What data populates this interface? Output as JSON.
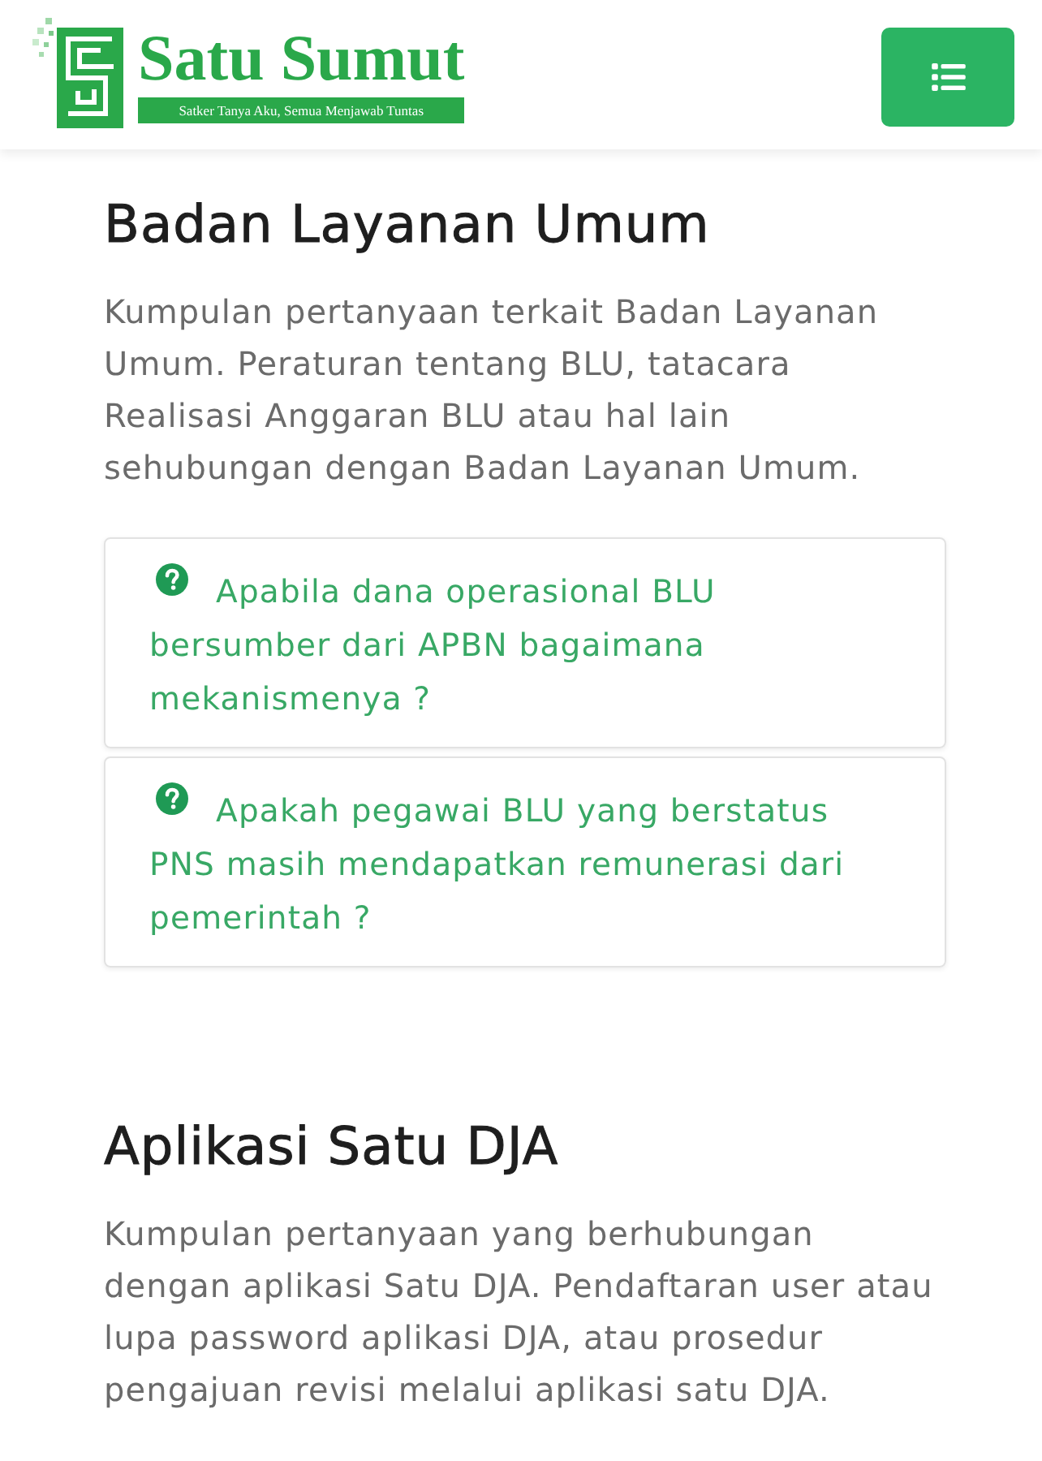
{
  "header": {
    "logo": {
      "title": "Satu Sumut",
      "tagline": "Satker Tanya Aku, Semua Menjawab Tuntas"
    }
  },
  "sections": [
    {
      "title": "Badan Layanan Umum",
      "description": "Kumpulan pertanyaan terkait Badan Layanan Umum. Peraturan tentang BLU, tatacara Realisasi Anggaran BLU atau hal lain sehubungan dengan Badan Layanan Umum.",
      "questions": [
        "Apabila dana operasional BLU bersumber dari APBN bagaimana mekanismenya ?",
        "Apakah pegawai BLU yang berstatus PNS masih mendapatkan remunerasi dari pemerintah ?"
      ]
    },
    {
      "title": "Aplikasi Satu DJA",
      "description": "Kumpulan pertanyaan yang berhubungan dengan aplikasi Satu DJA. Pendaftaran user atau lupa password aplikasi DJA, atau prosedur pengajuan revisi melalui aplikasi satu DJA."
    }
  ]
}
